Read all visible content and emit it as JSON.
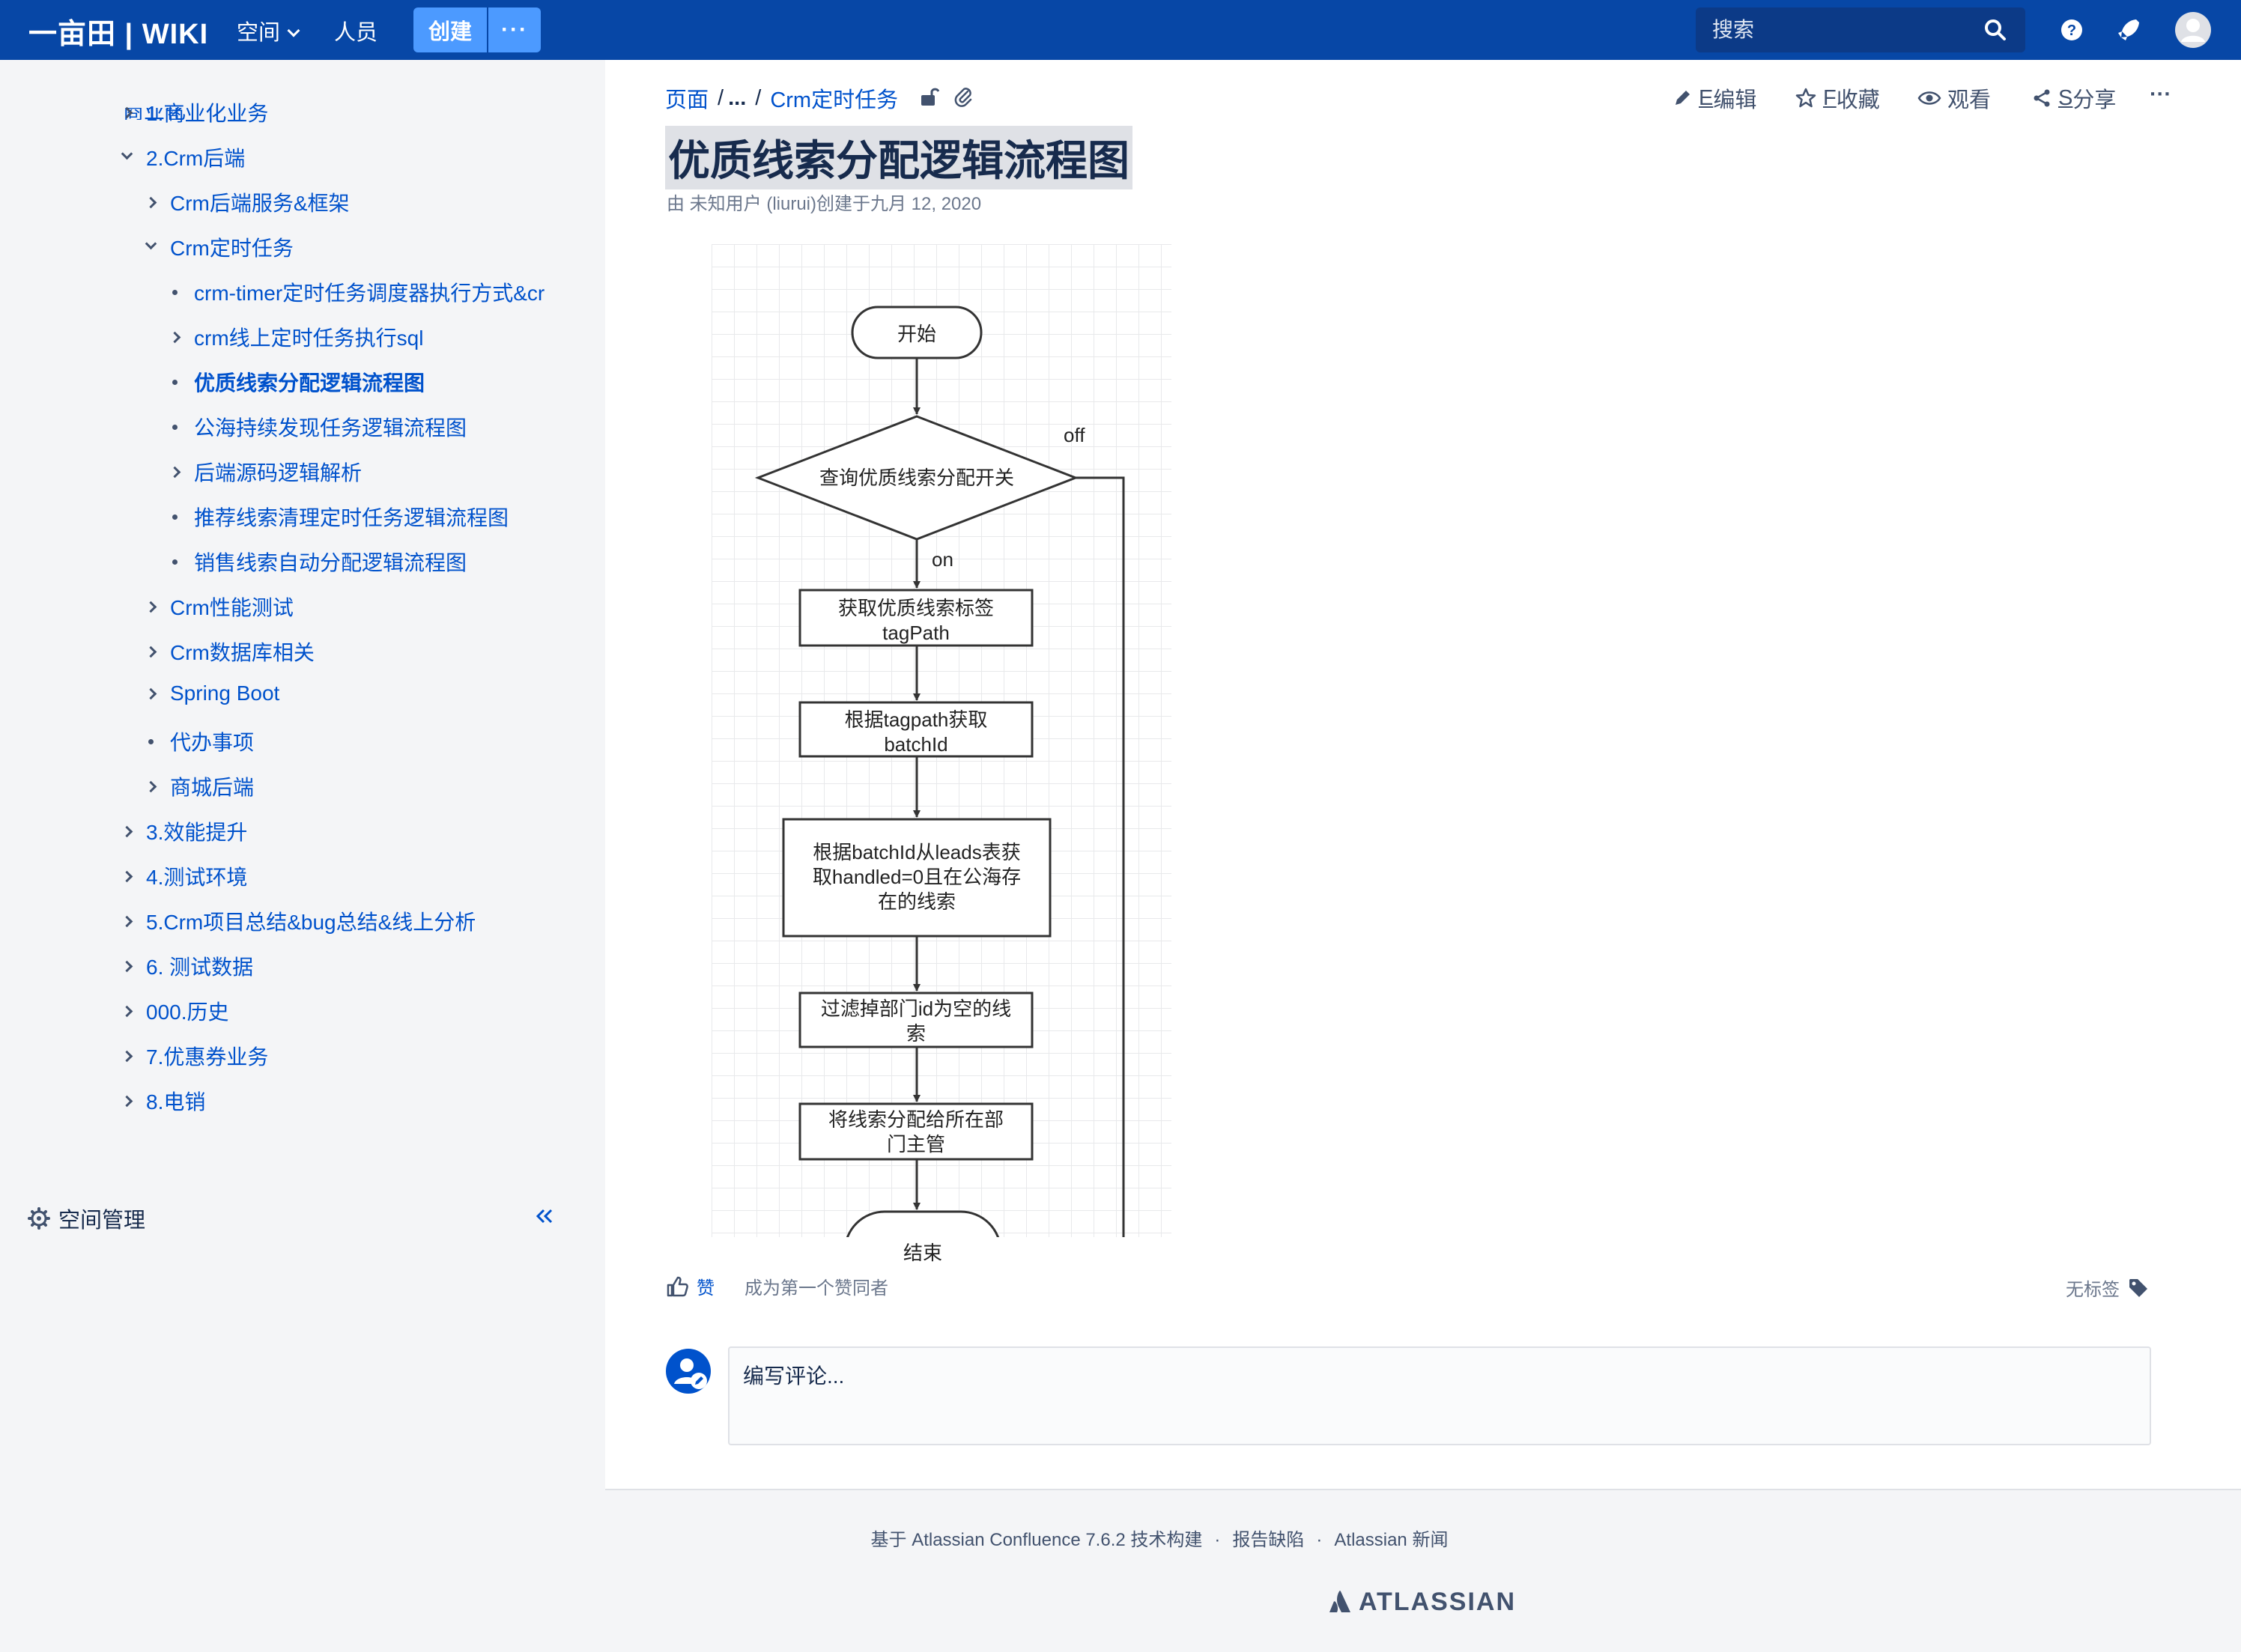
{
  "header": {
    "logo": "一亩田 | WIKI",
    "nav_spaces": "空间",
    "nav_people": "人员",
    "create": "创建",
    "more": "···",
    "search_placeholder": "搜索"
  },
  "sidebar": {
    "cut_item": "商业化",
    "items": [
      {
        "label": "1.商业化业务",
        "marker": "collapsed"
      },
      {
        "label": "2.Crm后端",
        "marker": "expanded"
      },
      {
        "label": "Crm后端服务&框架",
        "marker": "collapsed"
      },
      {
        "label": "Crm定时任务",
        "marker": "expanded"
      },
      {
        "label": "crm-timer定时任务调度器执行方式&cr",
        "marker": "leaf"
      },
      {
        "label": "crm线上定时任务执行sql",
        "marker": "collapsed"
      },
      {
        "label": "优质线索分配逻辑流程图",
        "marker": "leaf",
        "active": true
      },
      {
        "label": "公海持续发现任务逻辑流程图",
        "marker": "leaf"
      },
      {
        "label": "后端源码逻辑解析",
        "marker": "collapsed"
      },
      {
        "label": "推荐线索清理定时任务逻辑流程图",
        "marker": "leaf"
      },
      {
        "label": "销售线索自动分配逻辑流程图",
        "marker": "leaf"
      },
      {
        "label": "Crm性能测试",
        "marker": "collapsed"
      },
      {
        "label": "Crm数据库相关",
        "marker": "collapsed"
      },
      {
        "label": "Spring Boot",
        "marker": "collapsed"
      },
      {
        "label": "代办事项",
        "marker": "leaf"
      },
      {
        "label": "商城后端",
        "marker": "collapsed"
      },
      {
        "label": "3.效能提升",
        "marker": "collapsed"
      },
      {
        "label": "4.测试环境",
        "marker": "collapsed"
      },
      {
        "label": "5.Crm项目总结&bug总结&线上分析",
        "marker": "collapsed"
      },
      {
        "label": "6. 测试数据",
        "marker": "collapsed"
      },
      {
        "label": "000.历史",
        "marker": "collapsed"
      },
      {
        "label": "7.优惠券业务",
        "marker": "collapsed"
      },
      {
        "label": "8.电销",
        "marker": "collapsed"
      }
    ],
    "space_admin": "空间管理"
  },
  "breadcrumb": {
    "root": "页面",
    "ellipsis": "...",
    "parent": "Crm定时任务"
  },
  "actions": {
    "edit_key": "E",
    "edit": "编辑",
    "favorite_key": "F",
    "favorite": "收藏",
    "watch": "观看",
    "share_key": "S",
    "share": "分享",
    "more": "···"
  },
  "page": {
    "title": "优质线索分配逻辑流程图",
    "byline": "由 未知用户 (liurui)创建于九月 12, 2020"
  },
  "flowchart": {
    "start": "开始",
    "decision": "查询优质线索分配开关",
    "off_label": "off",
    "on_label": "on",
    "step1_line1": "获取优质线索标签",
    "step1_line2": "tagPath",
    "step2_line1": "根据tagpath获取",
    "step2_line2": "batchId",
    "step3_line1": "根据batchId从leads表获",
    "step3_line2": "取handled=0且在公海存",
    "step3_line3": "在的线索",
    "step4_line1": "过滤掉部门id为空的线",
    "step4_line2": "索",
    "step5_line1": "将线索分配给所在部",
    "step5_line2": "门主管",
    "end": "结束"
  },
  "likes": {
    "like": "赞",
    "first": "成为第一个赞同者",
    "no_labels": "无标签"
  },
  "comment": {
    "placeholder": "编写评论..."
  },
  "footer": {
    "built_with": "基于 Atlassian Confluence 7.6.2 技术构建",
    "report_bug": "报告缺陷",
    "news": "Atlassian 新闻",
    "brand": "ATLASSIAN"
  },
  "colors": {
    "header_bg": "#0747a6",
    "button_bg": "#4c9aff",
    "link": "#0052cc",
    "text": "#172b4d"
  }
}
